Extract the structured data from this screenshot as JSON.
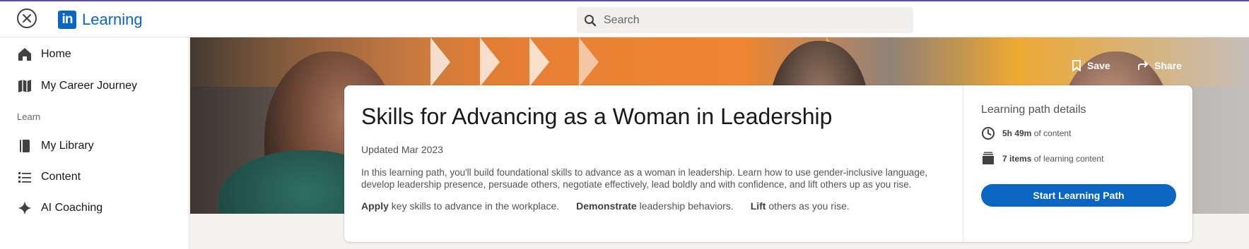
{
  "app": {
    "logo_mark": "in",
    "title": "Learning"
  },
  "search": {
    "placeholder": "Search",
    "value": ""
  },
  "sidebar": {
    "items": [
      {
        "label": "Home",
        "icon": "home-icon"
      },
      {
        "label": "My Career Journey",
        "icon": "map-icon"
      }
    ],
    "section_label": "Learn",
    "learn_items": [
      {
        "label": "My Library",
        "icon": "book-icon"
      },
      {
        "label": "Content",
        "icon": "list-icon"
      },
      {
        "label": "AI Coaching",
        "icon": "sparkle-icon"
      }
    ]
  },
  "hero": {
    "save_label": "Save",
    "share_label": "Share"
  },
  "course": {
    "title": "Skills for Advancing as a Woman in Leadership",
    "updated": "Updated Mar 2023",
    "description": "In this learning path, you'll build foundational skills to advance as a woman in leadership. Learn how to use gender-inclusive language, develop leadership presence, persuade others, negotiate effectively, lead boldly and with confidence, and lift others up as you rise.",
    "skills": [
      {
        "verb": "Apply",
        "rest": " key skills to advance in the workplace."
      },
      {
        "verb": "Demonstrate",
        "rest": " leadership behaviors."
      },
      {
        "verb": "Lift",
        "rest": " others as you rise."
      }
    ]
  },
  "details": {
    "title": "Learning path details",
    "duration_value": "5h 49m",
    "duration_suffix": " of content",
    "items_value": "7 items",
    "items_suffix": " of learning content",
    "start_label": "Start Learning Path"
  },
  "colors": {
    "brand": "#0a66c2",
    "accent_topline": "#5b4fa0"
  }
}
